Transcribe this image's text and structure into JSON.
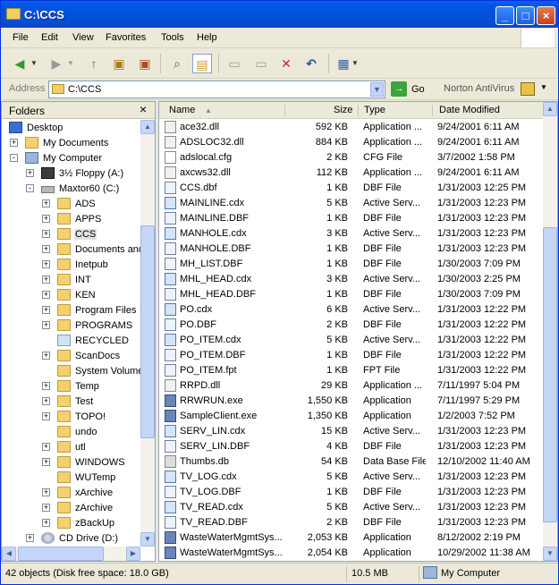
{
  "window": {
    "title": "C:\\CCS"
  },
  "menu": [
    "File",
    "Edit",
    "View",
    "Favorites",
    "Tools",
    "Help"
  ],
  "address": {
    "label": "Address",
    "value": "C:\\CCS",
    "go_label": "Go",
    "norton_label": "Norton AntiVirus"
  },
  "folders": {
    "title": "Folders",
    "close": "×",
    "items": [
      {
        "label": "Desktop"
      },
      {
        "label": "My Documents"
      },
      {
        "label": "My Computer"
      },
      {
        "label": "3½ Floppy (A:)"
      },
      {
        "label": "Maxtor60 (C:)"
      },
      {
        "label": "ADS"
      },
      {
        "label": "APPS"
      },
      {
        "label": "CCS"
      },
      {
        "label": "Documents and"
      },
      {
        "label": "Inetpub"
      },
      {
        "label": "INT"
      },
      {
        "label": "KEN"
      },
      {
        "label": "Program Files"
      },
      {
        "label": "PROGRAMS"
      },
      {
        "label": "RECYCLED"
      },
      {
        "label": "ScanDocs"
      },
      {
        "label": "System Volume"
      },
      {
        "label": "Temp"
      },
      {
        "label": "Test"
      },
      {
        "label": "TOPO!"
      },
      {
        "label": "undo"
      },
      {
        "label": "utl"
      },
      {
        "label": "WINDOWS"
      },
      {
        "label": "WUTemp"
      },
      {
        "label": "xArchive"
      },
      {
        "label": "zArchive"
      },
      {
        "label": "zBackUp"
      },
      {
        "label": "CD Drive (D:)"
      }
    ]
  },
  "list": {
    "headers": {
      "name": "Name",
      "size": "Size",
      "type": "Type",
      "date": "Date Modified"
    },
    "rows": [
      {
        "name": "ace32.dll",
        "size": "592 KB",
        "type": "Application ...",
        "date": "9/24/2001 6:11 AM",
        "icon": "dll"
      },
      {
        "name": "ADSLOC32.dll",
        "size": "884 KB",
        "type": "Application ...",
        "date": "9/24/2001 6:11 AM",
        "icon": "dll"
      },
      {
        "name": "adslocal.cfg",
        "size": "2 KB",
        "type": "CFG File",
        "date": "3/7/2002 1:58 PM",
        "icon": "cfg"
      },
      {
        "name": "axcws32.dll",
        "size": "112 KB",
        "type": "Application ...",
        "date": "9/24/2001 6:11 AM",
        "icon": "dll"
      },
      {
        "name": "CCS.dbf",
        "size": "1 KB",
        "type": "DBF File",
        "date": "1/31/2003 12:25 PM",
        "icon": "dbf"
      },
      {
        "name": "MAINLINE.cdx",
        "size": "5 KB",
        "type": "Active Serv...",
        "date": "1/31/2003 12:23 PM",
        "icon": "cdx"
      },
      {
        "name": "MAINLINE.DBF",
        "size": "1 KB",
        "type": "DBF File",
        "date": "1/31/2003 12:23 PM",
        "icon": "dbf"
      },
      {
        "name": "MANHOLE.cdx",
        "size": "3 KB",
        "type": "Active Serv...",
        "date": "1/31/2003 12:23 PM",
        "icon": "cdx"
      },
      {
        "name": "MANHOLE.DBF",
        "size": "1 KB",
        "type": "DBF File",
        "date": "1/31/2003 12:23 PM",
        "icon": "dbf"
      },
      {
        "name": "MH_LIST.DBF",
        "size": "1 KB",
        "type": "DBF File",
        "date": "1/30/2003 7:09 PM",
        "icon": "dbf"
      },
      {
        "name": "MHL_HEAD.cdx",
        "size": "3 KB",
        "type": "Active Serv...",
        "date": "1/30/2003 2:25 PM",
        "icon": "cdx"
      },
      {
        "name": "MHL_HEAD.DBF",
        "size": "1 KB",
        "type": "DBF File",
        "date": "1/30/2003 7:09 PM",
        "icon": "dbf"
      },
      {
        "name": "PO.cdx",
        "size": "6 KB",
        "type": "Active Serv...",
        "date": "1/31/2003 12:22 PM",
        "icon": "cdx"
      },
      {
        "name": "PO.DBF",
        "size": "2 KB",
        "type": "DBF File",
        "date": "1/31/2003 12:22 PM",
        "icon": "dbf"
      },
      {
        "name": "PO_ITEM.cdx",
        "size": "5 KB",
        "type": "Active Serv...",
        "date": "1/31/2003 12:22 PM",
        "icon": "cdx"
      },
      {
        "name": "PO_ITEM.DBF",
        "size": "1 KB",
        "type": "DBF File",
        "date": "1/31/2003 12:22 PM",
        "icon": "dbf"
      },
      {
        "name": "PO_ITEM.fpt",
        "size": "1 KB",
        "type": "FPT File",
        "date": "1/31/2003 12:22 PM",
        "icon": "dbf"
      },
      {
        "name": "RRPD.dll",
        "size": "29 KB",
        "type": "Application ...",
        "date": "7/11/1997 5:04 PM",
        "icon": "dll"
      },
      {
        "name": "RRWRUN.exe",
        "size": "1,550 KB",
        "type": "Application",
        "date": "7/11/1997 5:29 PM",
        "icon": "exe"
      },
      {
        "name": "SampleClient.exe",
        "size": "1,350 KB",
        "type": "Application",
        "date": "1/2/2003 7:52 PM",
        "icon": "exe"
      },
      {
        "name": "SERV_LIN.cdx",
        "size": "15 KB",
        "type": "Active Serv...",
        "date": "1/31/2003 12:23 PM",
        "icon": "cdx"
      },
      {
        "name": "SERV_LIN.DBF",
        "size": "4 KB",
        "type": "DBF File",
        "date": "1/31/2003 12:23 PM",
        "icon": "dbf"
      },
      {
        "name": "Thumbs.db",
        "size": "54 KB",
        "type": "Data Base File",
        "date": "12/10/2002 11:40 AM",
        "icon": "db"
      },
      {
        "name": "TV_LOG.cdx",
        "size": "5 KB",
        "type": "Active Serv...",
        "date": "1/31/2003 12:23 PM",
        "icon": "cdx"
      },
      {
        "name": "TV_LOG.DBF",
        "size": "1 KB",
        "type": "DBF File",
        "date": "1/31/2003 12:23 PM",
        "icon": "dbf"
      },
      {
        "name": "TV_READ.cdx",
        "size": "5 KB",
        "type": "Active Serv...",
        "date": "1/31/2003 12:23 PM",
        "icon": "cdx"
      },
      {
        "name": "TV_READ.DBF",
        "size": "2 KB",
        "type": "DBF File",
        "date": "1/31/2003 12:23 PM",
        "icon": "dbf"
      },
      {
        "name": "WasteWaterMgmtSys...",
        "size": "2,053 KB",
        "type": "Application",
        "date": "8/12/2002 2:19 PM",
        "icon": "exe"
      },
      {
        "name": "WasteWaterMgmtSys...",
        "size": "2,054 KB",
        "type": "Application",
        "date": "10/29/2002 11:38 AM",
        "icon": "exe"
      }
    ]
  },
  "status": {
    "objects": "42 objects (Disk free space: 18.0 GB)",
    "size": "10.5 MB",
    "location": "My Computer"
  }
}
